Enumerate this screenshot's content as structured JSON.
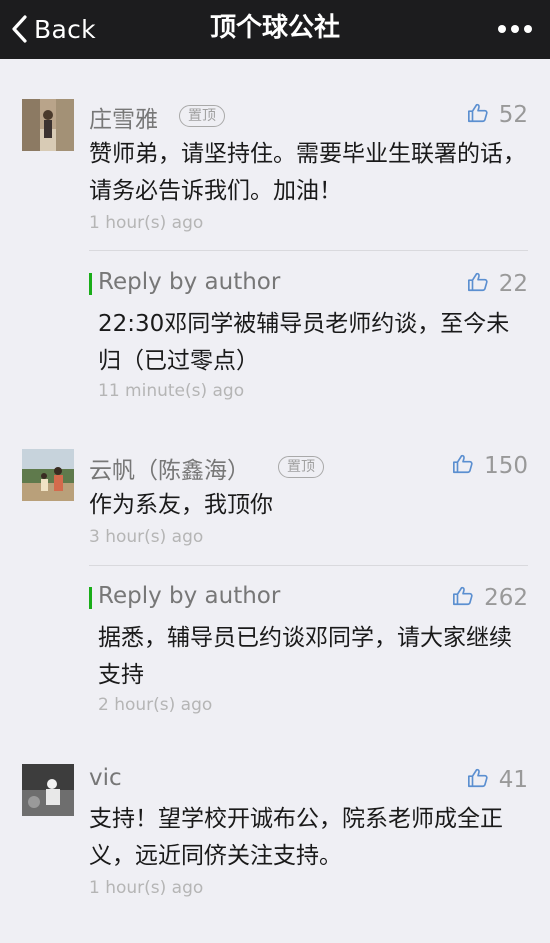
{
  "nav": {
    "back_label": "Back",
    "title": "顶个球公社",
    "back_icon": "chevron-left-icon",
    "more_icon": "ellipsis-icon"
  },
  "comments": [
    {
      "name": "庄雪雅",
      "badge": "置顶",
      "likes": "52",
      "text": "赞师弟，请坚持住。需要毕业生联署的话，请务必告诉我们。加油！",
      "time": "1 hour(s) ago",
      "reply": {
        "label": "Reply by author",
        "likes": "22",
        "text": "22:30邓同学被辅导员老师约谈，至今未归（已过零点）",
        "time": "11 minute(s) ago"
      }
    },
    {
      "name": "云帆（陈鑫海）",
      "badge": "置顶",
      "likes": "150",
      "text": "作为系友，我顶你",
      "time": "3 hour(s) ago",
      "reply": {
        "label": "Reply by author",
        "likes": "262",
        "text": "据悉，辅导员已约谈邓同学，请大家继续支持",
        "time": "2 hour(s) ago"
      }
    },
    {
      "name": "vic",
      "likes": "41",
      "text": "支持！望学校开诚布公，院系老师成全正义，远近同侪关注支持。",
      "time": "1 hour(s) ago"
    }
  ],
  "colors": {
    "nav_bg": "#1c1c1e",
    "page_bg": "#efeff4",
    "reply_accent": "#1aad19",
    "like_icon": "#5b8fd0"
  }
}
